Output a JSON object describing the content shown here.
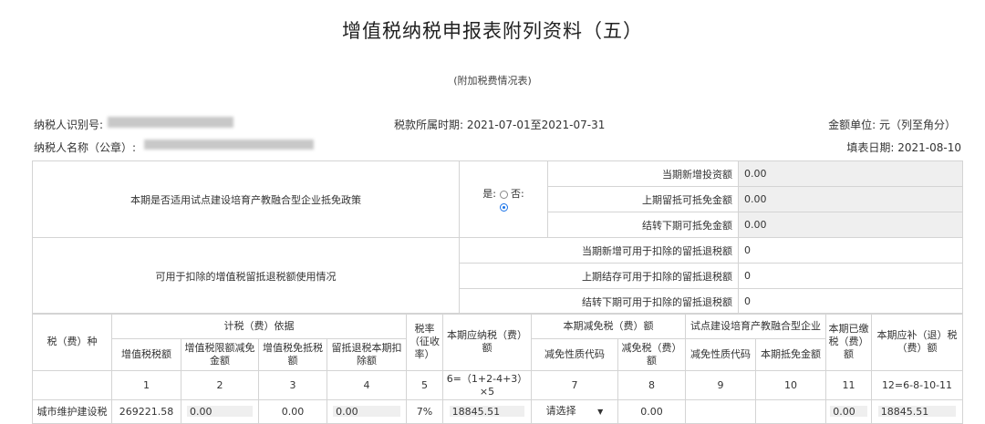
{
  "header": {
    "title": "增值税纳税申报表附列资料（五）",
    "subtitle": "(附加税费情况表)",
    "taxpayer_id_label": "纳税人识别号:",
    "period_label": "税款所属时期: 2021-07-01至2021-07-31",
    "unit_label": "金额单位: 元（列至角分）",
    "taxpayer_name_label": "纳税人名称（公章）:",
    "fill_date_label": "填表日期: 2021-08-10"
  },
  "policy": {
    "question": "本期是否适用试点建设培育产教融合型企业抵免政策",
    "yes_label": "是:",
    "no_label": "否:",
    "selected": "否",
    "rows": [
      {
        "label": "当期新增投资额",
        "value": "0.00"
      },
      {
        "label": "上期留抵可抵免金额",
        "value": "0.00"
      },
      {
        "label": "结转下期可抵免金额",
        "value": "0.00"
      }
    ]
  },
  "refund": {
    "label": "可用于扣除的增值税留抵退税额使用情况",
    "rows": [
      {
        "label": "当期新增可用于扣除的留抵退税额",
        "value": "0"
      },
      {
        "label": "上期结存可用于扣除的留抵退税额",
        "value": "0"
      },
      {
        "label": "结转下期可用于扣除的留抵退税额",
        "value": "0"
      }
    ]
  },
  "main_table": {
    "h_tax_type": "税（费）种",
    "h_basis": "计税（费）依据",
    "h_rate": "税率（征收率）",
    "h_payable": "本期应纳税（费）额",
    "h_reduction": "本期减免税（费）额",
    "h_pilot": "试点建设培育产教融合型企业",
    "h_paid": "本期已缴税（费）额",
    "h_supplement": "本期应补（退）税（费）额",
    "sub": [
      "增值税税额",
      "增值税限额减免金额",
      "增值税免抵税额",
      "留抵退税本期扣除额",
      "减免性质代码",
      "减免税（费）额",
      "减免性质代码",
      "本期抵免金额"
    ],
    "nums": [
      "1",
      "2",
      "3",
      "4",
      "5",
      "6=（1+2-4+3）×5",
      "7",
      "8",
      "9",
      "10",
      "11",
      "12=6-8-10-11"
    ],
    "row1": {
      "name": "城市维护建设税",
      "c1": "269221.58",
      "c2": "0.00",
      "c3": "0.00",
      "c4": "0.00",
      "c5": "7%",
      "c6": "18845.51",
      "c7": "请选择",
      "c8": "0.00",
      "c11": "0.00",
      "c12": "18845.51"
    }
  }
}
